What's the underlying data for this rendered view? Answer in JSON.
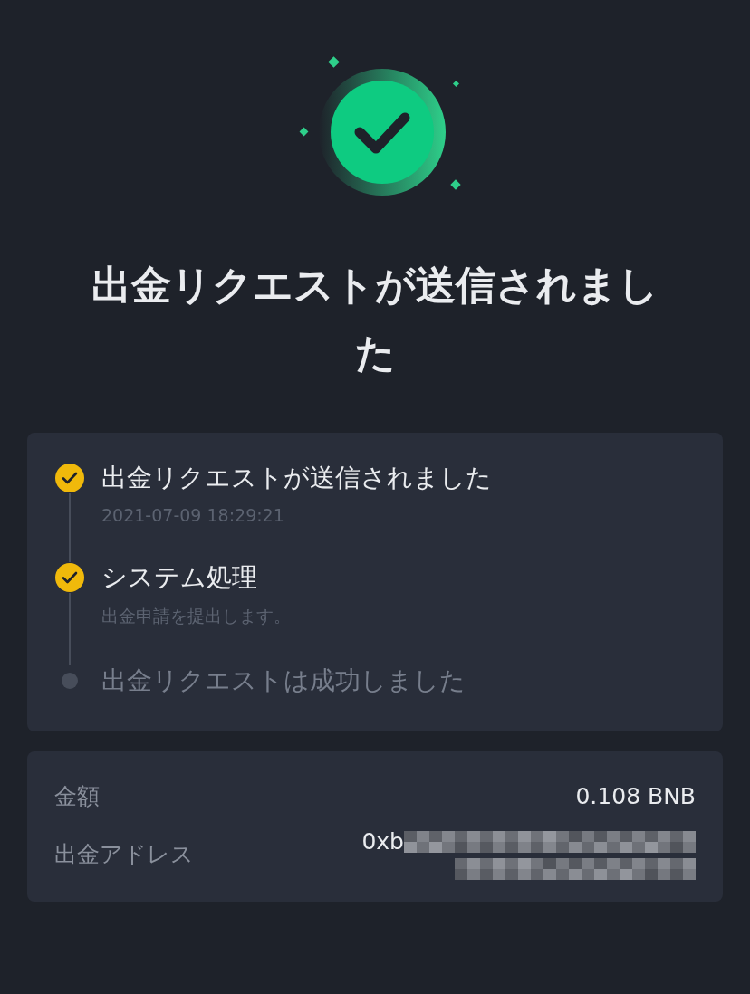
{
  "title": "出金リクエストが送信されました",
  "steps": [
    {
      "kind": "done",
      "label": "出金リクエストが送信されました",
      "detail": "2021-07-09 18:29:21"
    },
    {
      "kind": "done",
      "label": "システム処理",
      "detail": "出金申請を提出します。"
    },
    {
      "kind": "pending",
      "label": "出金リクエストは成功しました"
    }
  ],
  "details": [
    {
      "kind": "text",
      "label": "金額",
      "value": "0.108 BNB"
    },
    {
      "kind": "redacted",
      "label": "出金アドレス",
      "value": "0xb"
    }
  ]
}
